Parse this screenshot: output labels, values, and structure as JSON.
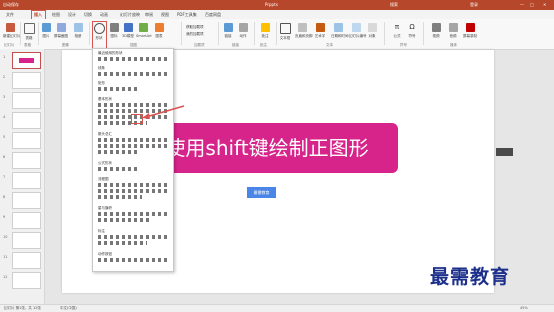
{
  "titlebar": {
    "left_label": "自动保存",
    "center_title": "Prpptx",
    "search_hint": "搜索",
    "account": "登录"
  },
  "menu_tabs": [
    "文件",
    "插入",
    "绘图",
    "设计",
    "切换",
    "动画",
    "幻灯片放映",
    "审阅",
    "视图",
    "PDF工具集",
    "百度网盘"
  ],
  "ribbon": {
    "buttons": [
      "新建幻灯片",
      "表格",
      "图片",
      "屏幕截图",
      "相册",
      "形状",
      "图标",
      "3D模型",
      "SmartArt",
      "图表",
      "加载项",
      "链接",
      "动作",
      "批注",
      "文本框",
      "页眉和页脚",
      "艺术字",
      "日期和时间",
      "幻灯片编号",
      "对象",
      "公式",
      "符号",
      "视频",
      "音频",
      "屏幕录制"
    ],
    "groups": [
      "幻灯片",
      "表格",
      "图像",
      "插图",
      "加载项",
      "链接",
      "批注",
      "文本",
      "符号",
      "媒体"
    ],
    "extra": [
      "获取加载项",
      "我的加载项"
    ]
  },
  "shapes_panel": {
    "sections": [
      "最近使用的形状",
      "线条",
      "矩形",
      "基本形状",
      "箭头总汇",
      "公式形状",
      "流程图",
      "星与旗帜",
      "标注",
      "动作按钮"
    ]
  },
  "slide": {
    "banner_text": "使用shift键绘制正图形",
    "button_text": "最需教育"
  },
  "thumbs": [
    "1",
    "2",
    "3",
    "4",
    "5",
    "6",
    "7",
    "8",
    "9",
    "10",
    "11",
    "12"
  ],
  "status": {
    "left": "幻灯片 第1张，共 12张",
    "lang": "中文(中国)",
    "zoom": "45%"
  },
  "watermark": "最需教育",
  "colors": {
    "accent": "#b7472a",
    "banner": "#d6248a",
    "button": "#4a86e8",
    "highlight": "#d9534f"
  }
}
